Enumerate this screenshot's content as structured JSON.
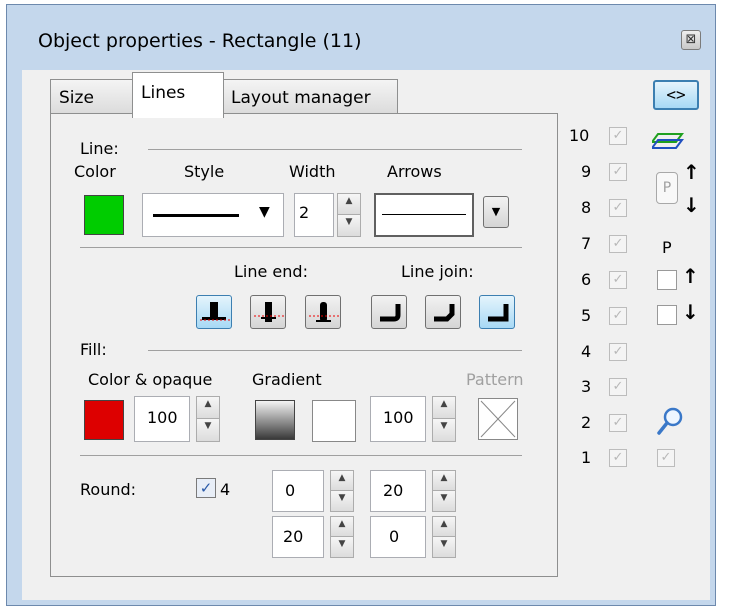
{
  "window": {
    "title": "Object properties - Rectangle (11)",
    "close_glyph": "⊠"
  },
  "tabs": [
    {
      "label": "Size",
      "active": false
    },
    {
      "label": "Lines",
      "active": true
    },
    {
      "label": "Layout manager",
      "active": false
    }
  ],
  "line": {
    "section_label": "Line:",
    "color_label": "Color",
    "style_label": "Style",
    "width_label": "Width",
    "arrows_label": "Arrows",
    "color": "#00cc00",
    "width_value": "2",
    "line_end_label": "Line end:",
    "line_join_label": "Line join:"
  },
  "fill": {
    "section_label": "Fill:",
    "color_opaque_label": "Color & opaque",
    "gradient_label": "Gradient",
    "pattern_label": "Pattern",
    "color": "#dd0000",
    "opacity_value": "100",
    "gradient_opacity_value": "100"
  },
  "round": {
    "label": "Round:",
    "checkbox_value": "4",
    "checked": true,
    "values": [
      "0",
      "20",
      "20",
      "0"
    ]
  },
  "layers": {
    "numbers": [
      "10",
      "9",
      "8",
      "7",
      "6",
      "5",
      "4",
      "3",
      "2",
      "1"
    ],
    "check_glyph": "✓"
  },
  "right_panel": {
    "code_button_label": "<>",
    "p_label": "P",
    "p_label_plain": "P",
    "up_arrow": "↑",
    "down_arrow": "↓",
    "icons": [
      "layers-icon",
      "magnifier-icon"
    ]
  },
  "colors": {
    "titlebar": "#c4d7ec",
    "selected_button": "#a7d9f5"
  }
}
